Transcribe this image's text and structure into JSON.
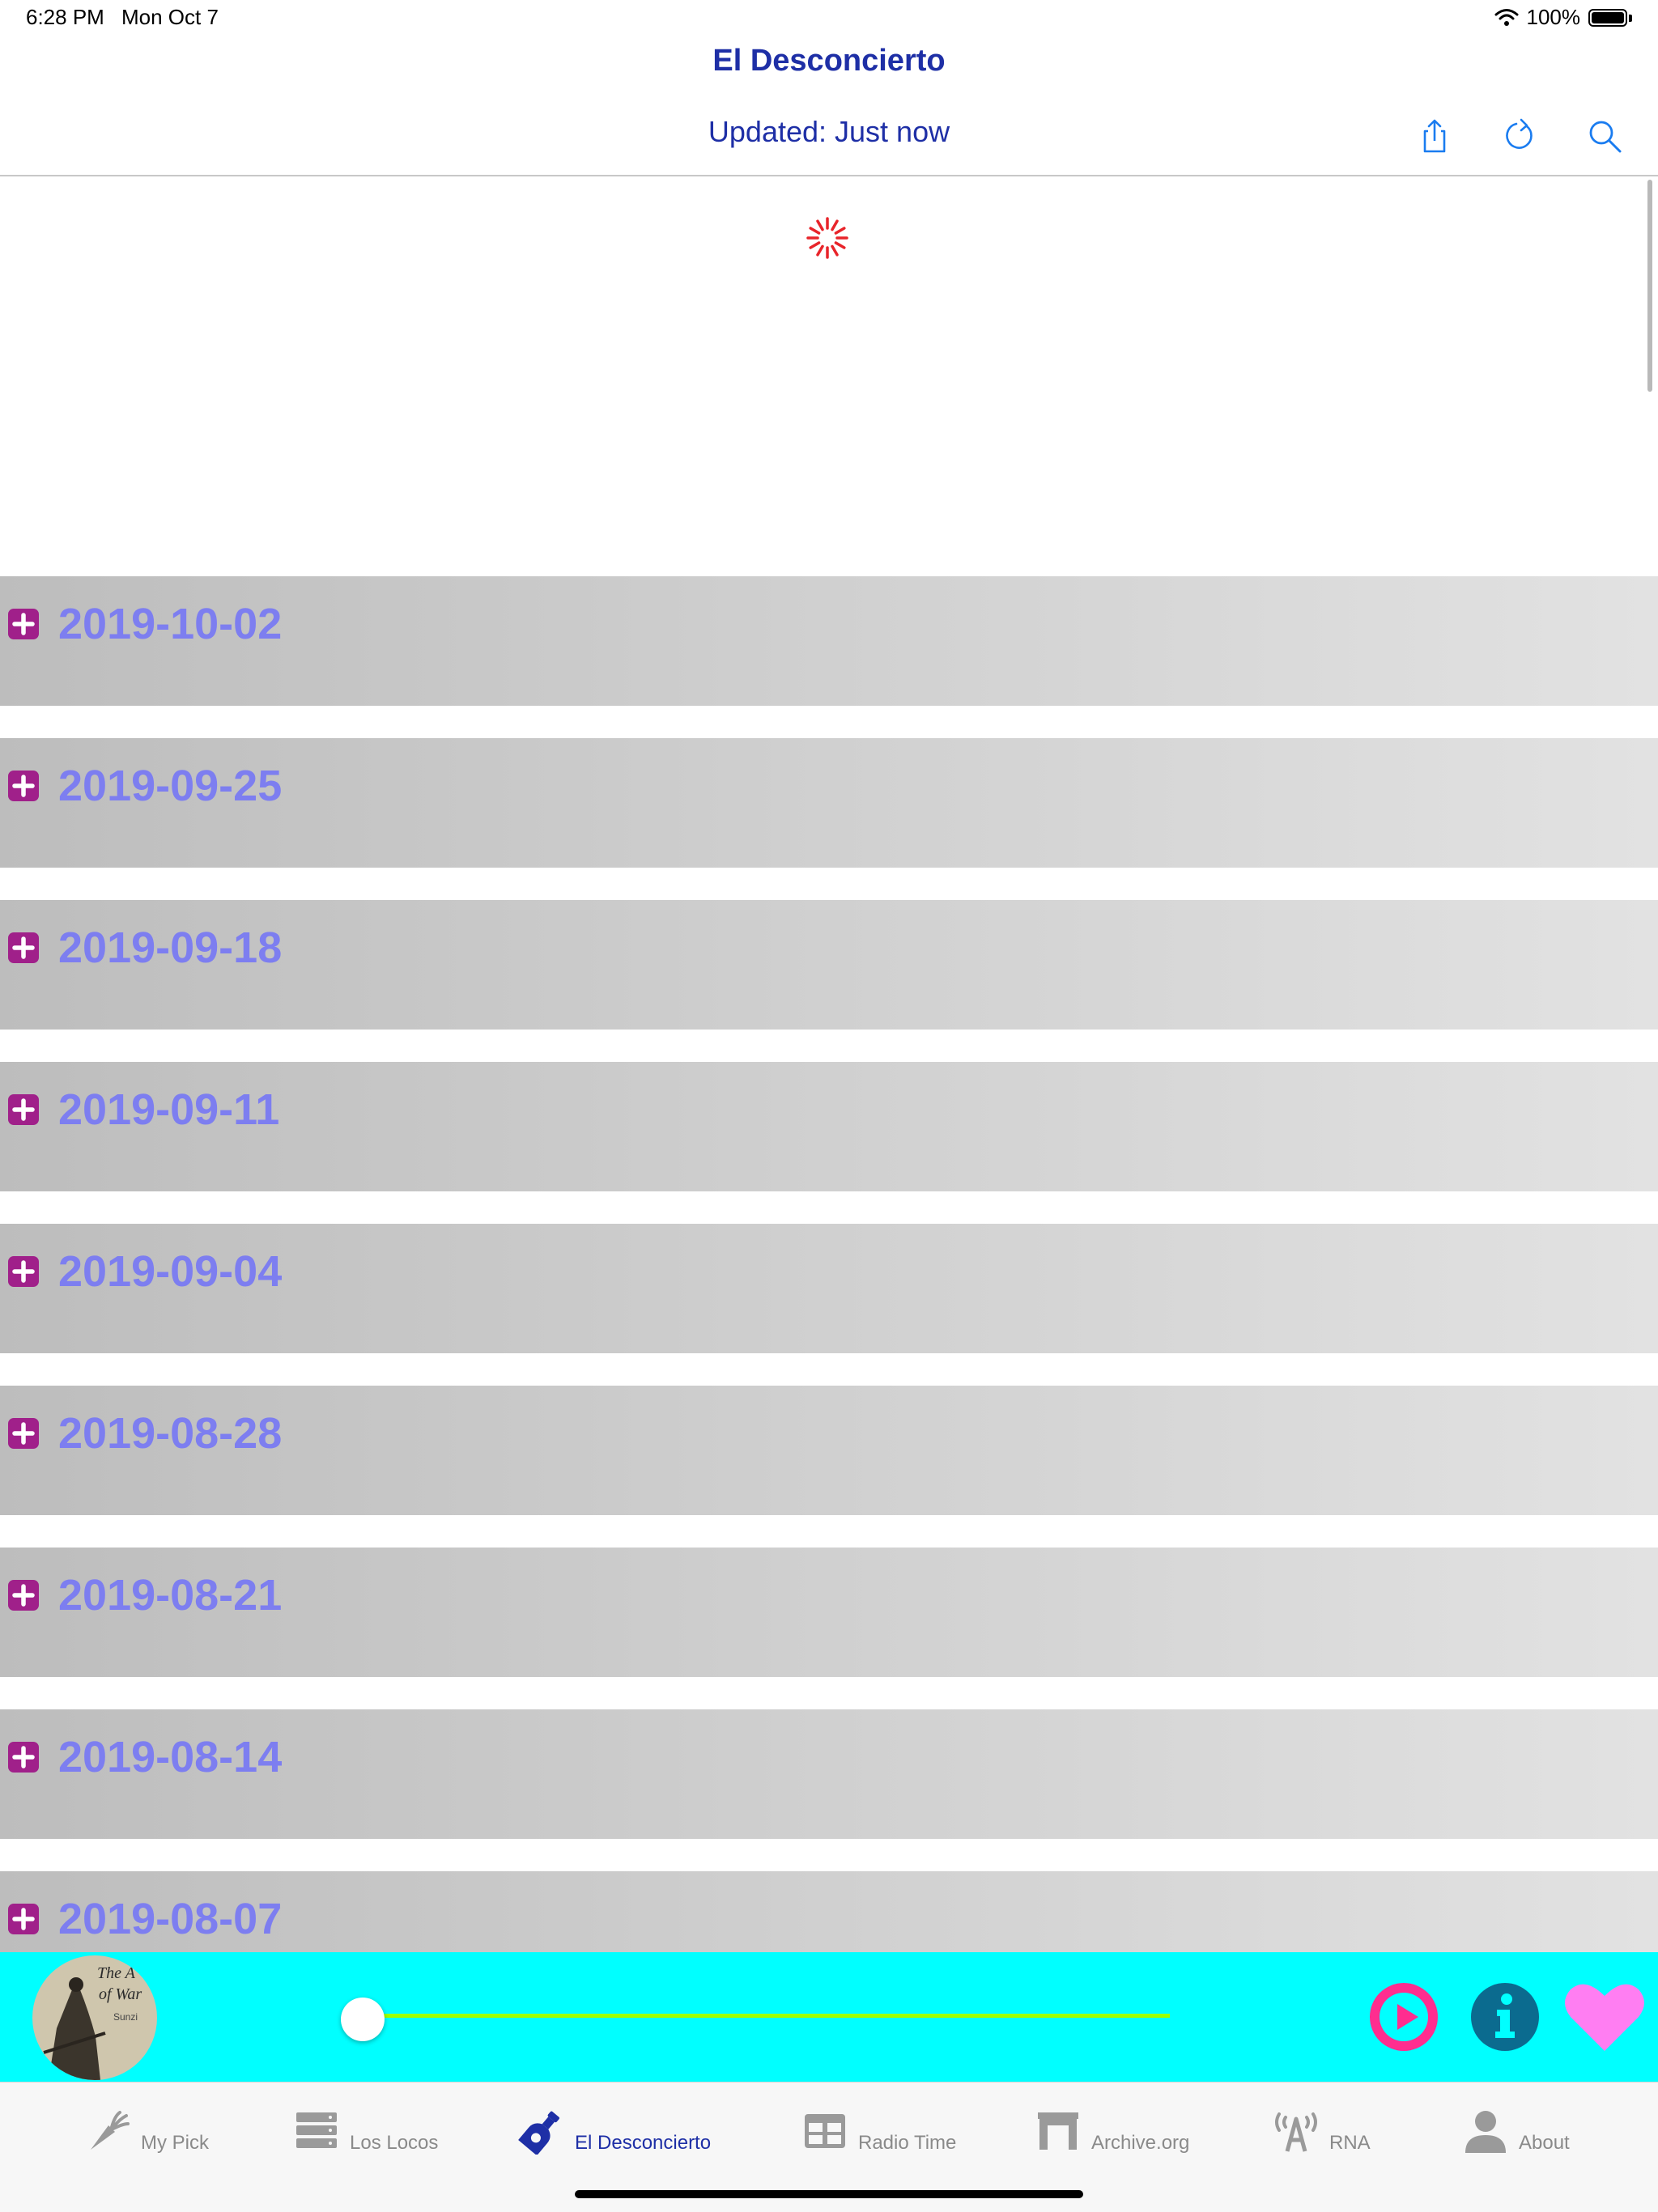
{
  "status_bar": {
    "time": "6:28 PM",
    "date": "Mon Oct 7",
    "battery": "100%"
  },
  "nav": {
    "title": "El Desconcierto",
    "subtitle": "Updated: Just now",
    "icons": [
      "share-icon",
      "refresh-icon",
      "search-icon"
    ]
  },
  "list": {
    "items": [
      {
        "label": "2019-10-02"
      },
      {
        "label": "2019-09-25"
      },
      {
        "label": "2019-09-18"
      },
      {
        "label": "2019-09-11"
      },
      {
        "label": "2019-09-04"
      },
      {
        "label": "2019-08-28"
      },
      {
        "label": "2019-08-21"
      },
      {
        "label": "2019-08-14"
      },
      {
        "label": "2019-08-07"
      }
    ]
  },
  "player": {
    "artwork_text": {
      "line1": "The A",
      "line2": "of War",
      "author": "Sunzi"
    },
    "progress": 0,
    "icons": [
      "play-icon",
      "info-icon",
      "heart-icon"
    ],
    "colors": {
      "background": "#00ffff",
      "track": "#9bff00",
      "play": "#ff2d8f",
      "info": "#0b6b8f",
      "heart": "#ff7ef2"
    }
  },
  "tabs": [
    {
      "label": "My Pick",
      "icon": "carrot-icon",
      "active": false
    },
    {
      "label": "Los Locos",
      "icon": "server-icon",
      "active": false
    },
    {
      "label": "El Desconcierto",
      "icon": "bottle-icon",
      "active": true
    },
    {
      "label": "Radio Time",
      "icon": "table-icon",
      "active": false
    },
    {
      "label": "Archive.org",
      "icon": "archive-arch-icon",
      "active": false
    },
    {
      "label": "RNA",
      "icon": "antenna-icon",
      "active": false
    },
    {
      "label": "About",
      "icon": "person-icon",
      "active": false
    }
  ],
  "colors": {
    "accent": "#1e2fa6",
    "date_text": "#7d7ef0",
    "plus_icon": "#a0208a",
    "spinner": "#e8242a"
  }
}
